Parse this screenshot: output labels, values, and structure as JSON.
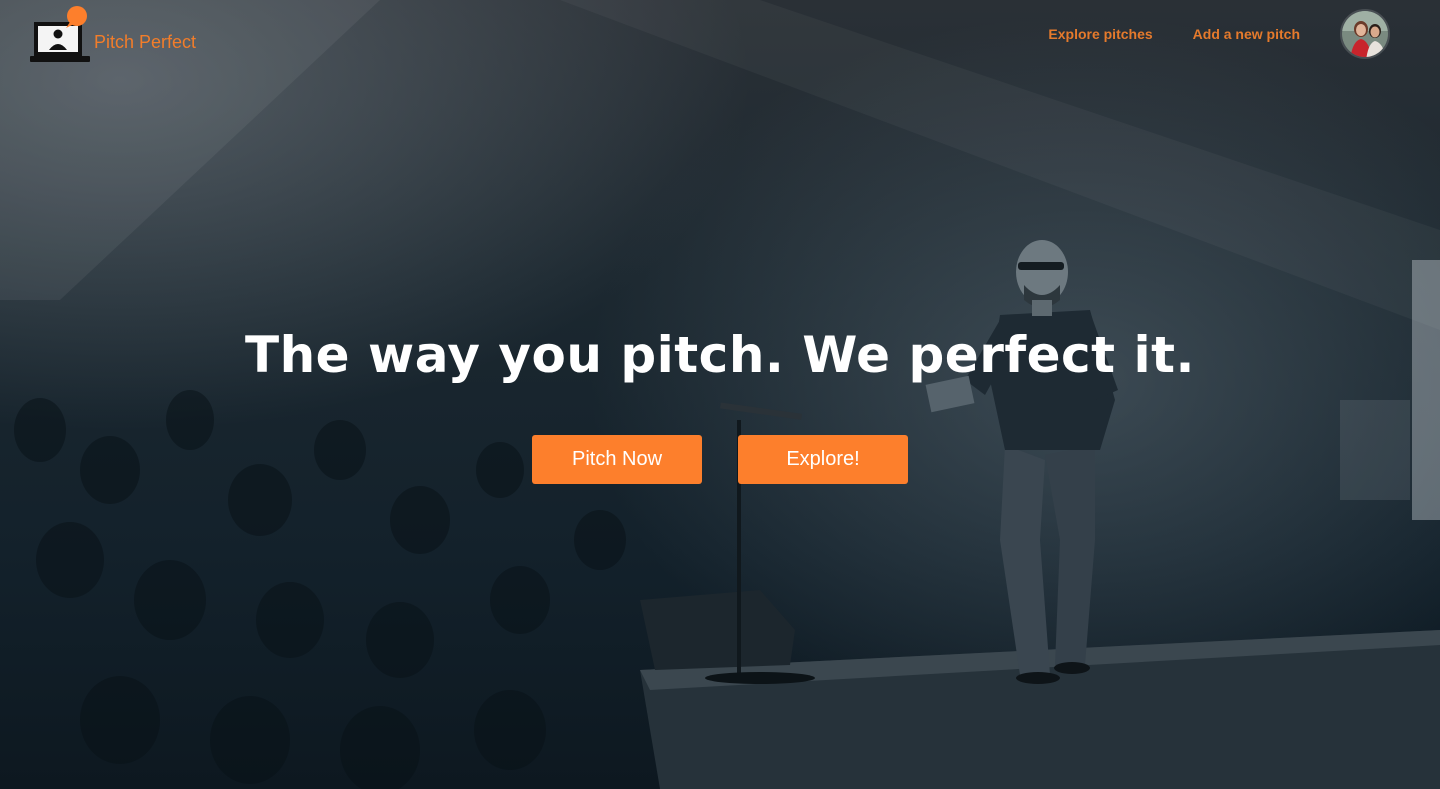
{
  "brand": {
    "name": "Pitch Perfect",
    "logo_icon": "laptop-presenter-icon",
    "accent": "#f27d2a"
  },
  "nav": {
    "explore_label": "Explore pitches",
    "add_label": "Add a new pitch"
  },
  "user": {
    "avatar_icon": "user-avatar-icon"
  },
  "hero": {
    "title": "The way you pitch. We perfect it.",
    "primary_cta": "Pitch Now",
    "secondary_cta": "Explore!",
    "button_color": "#fd7f2c"
  }
}
